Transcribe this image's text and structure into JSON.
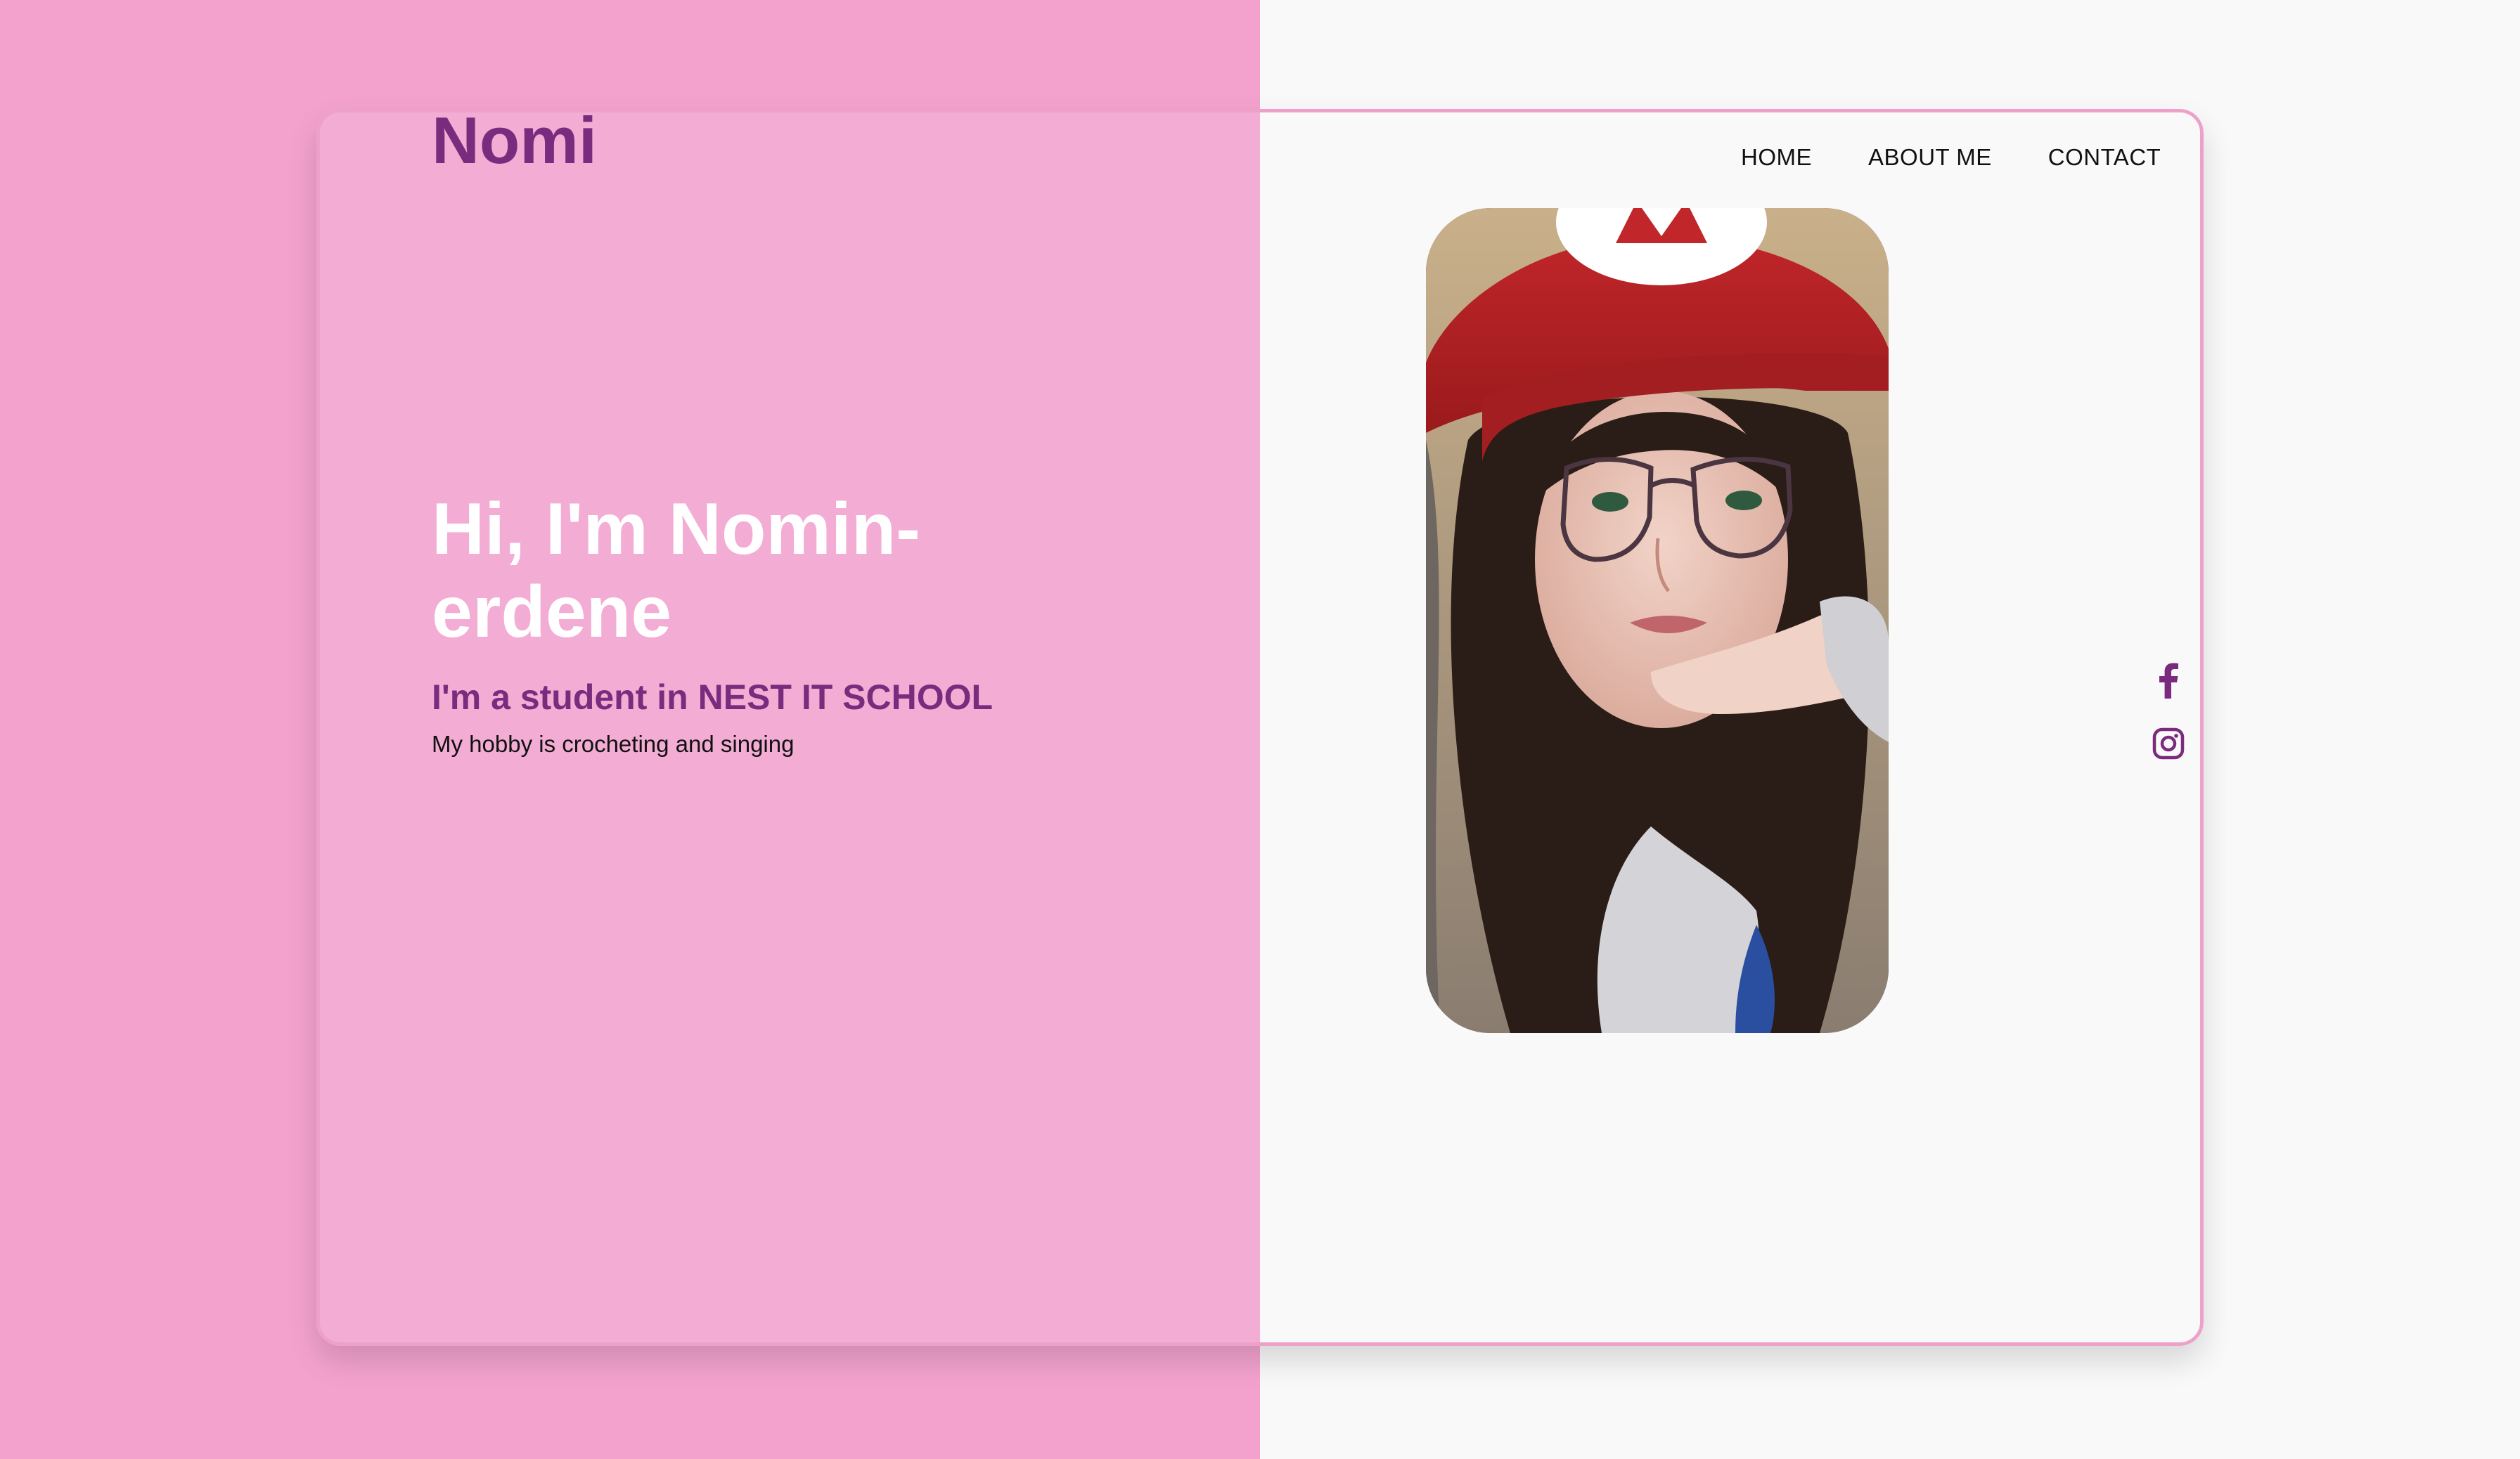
{
  "brand": {
    "name": "Nomi"
  },
  "nav": {
    "items": [
      {
        "label": "HOME"
      },
      {
        "label": "ABOUT ME"
      },
      {
        "label": "CONTACT"
      }
    ]
  },
  "hero": {
    "title": "Hi, I'm Nomin-erdene",
    "subtitle": "I'm a student in NEST IT SCHOOL",
    "text": "My hobby is crocheting and singing"
  },
  "social": {
    "items": [
      {
        "icon": "facebook-icon"
      },
      {
        "icon": "instagram-icon"
      }
    ]
  },
  "colors": {
    "page_left": "#f3a2ce",
    "page_right": "#f9f9f9",
    "card_left": "#f3acd4",
    "card_border": "#eea1c8",
    "accent": "#7b2b7e",
    "hero_text": "#ffffff"
  }
}
